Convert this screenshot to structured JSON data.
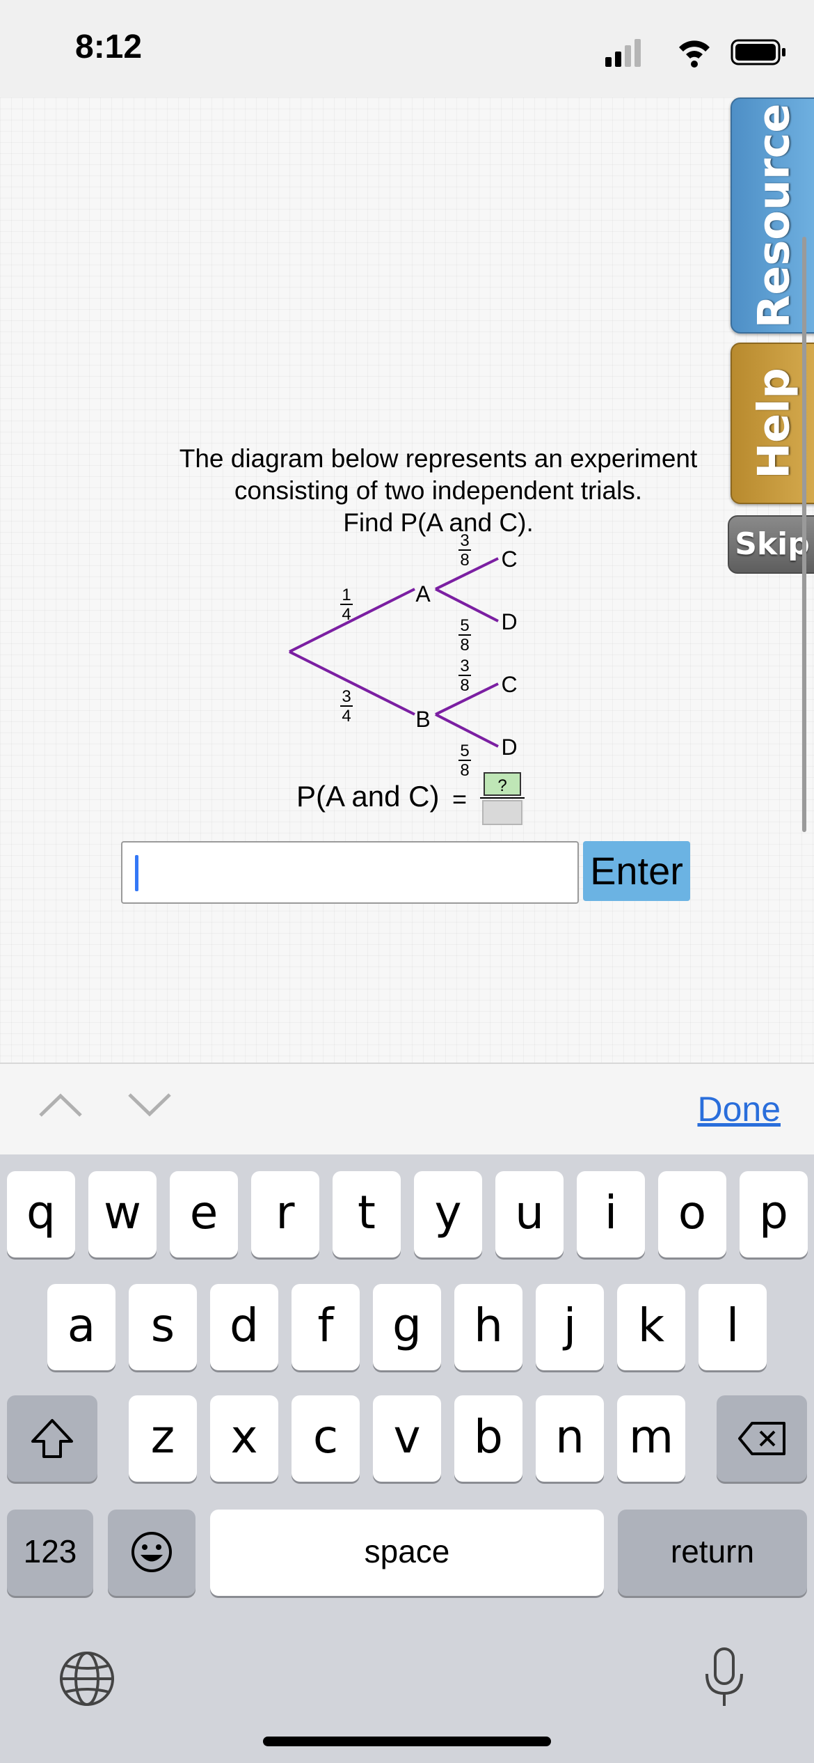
{
  "status": {
    "time": "8:12"
  },
  "side_tabs": {
    "resource_label": "Resource",
    "help_label": "Help",
    "skip_label": "Skip"
  },
  "question": {
    "line1": "The diagram below represents an experiment",
    "line2": "consisting of two independent trials.",
    "line3": "Find P(A and C)."
  },
  "tree": {
    "first_branches": [
      {
        "outcome": "A",
        "num": "1",
        "den": "4"
      },
      {
        "outcome": "B",
        "num": "3",
        "den": "4"
      }
    ],
    "second_branches": [
      {
        "parent": "A",
        "outcome": "C",
        "num": "3",
        "den": "8"
      },
      {
        "parent": "A",
        "outcome": "D",
        "num": "5",
        "den": "8"
      },
      {
        "parent": "B",
        "outcome": "C",
        "num": "3",
        "den": "8"
      },
      {
        "parent": "B",
        "outcome": "D",
        "num": "5",
        "den": "8"
      }
    ],
    "line_color": "#7b1fa2"
  },
  "equation": {
    "label": "P(A and C)",
    "equals": "=",
    "numerator_placeholder": "?"
  },
  "answer": {
    "value": "",
    "enter_label": "Enter"
  },
  "toolbar": {
    "done_label": "Done"
  },
  "keyboard": {
    "row1": [
      "q",
      "w",
      "e",
      "r",
      "t",
      "y",
      "u",
      "i",
      "o",
      "p"
    ],
    "row2": [
      "a",
      "s",
      "d",
      "f",
      "g",
      "h",
      "j",
      "k",
      "l"
    ],
    "row3": [
      "z",
      "x",
      "c",
      "v",
      "b",
      "n",
      "m"
    ],
    "numbers_label": "123",
    "space_label": "space",
    "return_label": "return"
  },
  "colors": {
    "accent": "#6bb3e3",
    "resource_tab": "#5b9fd4",
    "help_tab": "#c99b3c",
    "skip_tab": "#707070"
  }
}
